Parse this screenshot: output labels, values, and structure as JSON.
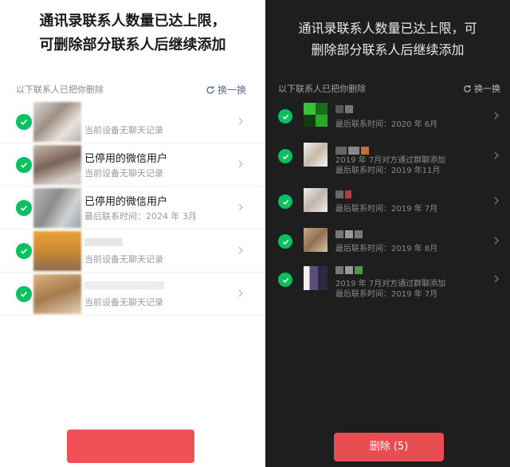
{
  "left_screen": {
    "title_line1": "通讯录联系人数量已达上限，",
    "title_line2": "可删除部分联系人后继续添加",
    "list_header": "以下联系人已把你删除",
    "refresh_label": "换一换",
    "contacts": [
      {
        "name": "",
        "subtitle": "当前设备无聊天记录",
        "selected": true
      },
      {
        "name": "已停用的微信用户",
        "subtitle": "当前设备无聊天记录",
        "selected": true
      },
      {
        "name": "已停用的微信用户",
        "subtitle": "最后联系时间：2024 年 3月",
        "selected": true
      },
      {
        "name": "",
        "subtitle": "当前设备无聊天记录",
        "selected": true
      },
      {
        "name": "",
        "subtitle": "当前设备无聊天记录",
        "selected": true
      }
    ],
    "delete_button": ""
  },
  "right_screen": {
    "title_line1": "通讯录联系人数量已达上限，可",
    "title_line2": "删除部分联系人后继续添加",
    "list_header": "以下联系人已把你删除",
    "refresh_label": "换一换",
    "contacts": [
      {
        "name": "",
        "line1": "最后联系时间：2020 年 6月",
        "line2": "",
        "selected": true
      },
      {
        "name": "",
        "line1": "2019 年 7月对方通过群聊添加",
        "line2": "最后联系时间：2019 年11月",
        "selected": true
      },
      {
        "name": "",
        "line1": "最后联系时间：2019 年 7月",
        "line2": "",
        "selected": true
      },
      {
        "name": "",
        "line1": "最后联系时间：2019 年 8月",
        "line2": "",
        "selected": true
      },
      {
        "name": "",
        "line1": "2019 年 7月对方通过群聊添加",
        "line2": "最后联系时间：2019 年 7月",
        "selected": true
      }
    ],
    "delete_button": "删除 (5)"
  },
  "colors": {
    "check_green": "#07c160",
    "delete_red": "#f05156",
    "dark_bg": "#1e1e1e",
    "link_blue": "#576b95"
  }
}
